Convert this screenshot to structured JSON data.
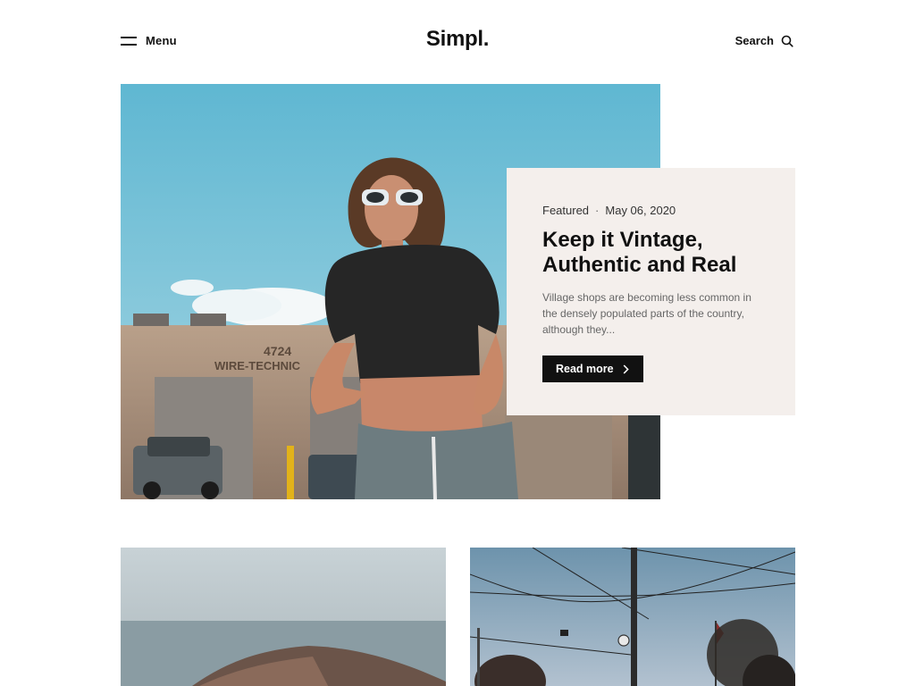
{
  "header": {
    "menu_label": "Menu",
    "logo": "Simpl.",
    "search_label": "Search",
    "menu_icon": "hamburger-icon",
    "search_icon": "search-icon"
  },
  "featured": {
    "category": "Featured",
    "separator": "·",
    "date": "May 06, 2020",
    "title": "Keep it Vintage, Authentic and Real",
    "excerpt": "Village shops are becoming less common in the densely populated parts of the country, although they...",
    "read_more": "Read more",
    "read_more_icon": "chevron-right-icon"
  },
  "building_sign": {
    "number": "4724",
    "name": "WIRE-TECHNIC"
  },
  "colors": {
    "card_bg": "#f4efec",
    "button_bg": "#111111",
    "sky": "#7dc4d8"
  }
}
